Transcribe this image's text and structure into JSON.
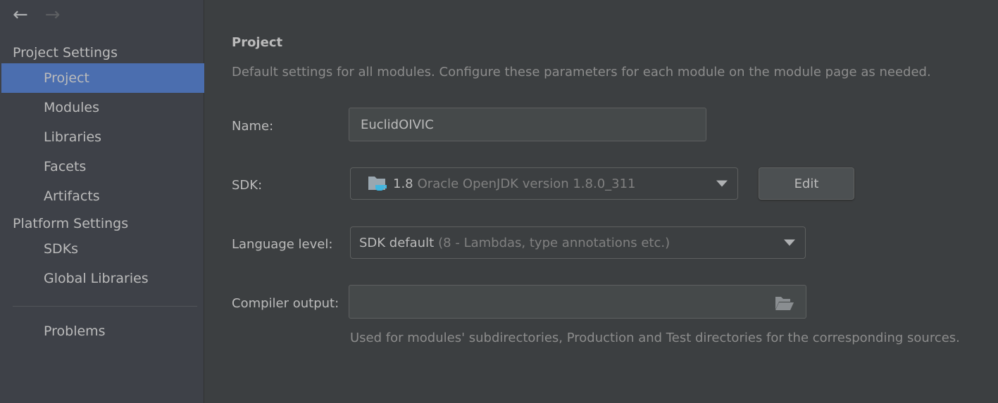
{
  "nav": {
    "back_icon": "arrow-left",
    "forward_icon": "arrow-right"
  },
  "sidebar": {
    "project_settings": "Project Settings",
    "project_items": [
      {
        "label": "Project",
        "selected": true
      },
      {
        "label": "Modules"
      },
      {
        "label": "Libraries"
      },
      {
        "label": "Facets"
      },
      {
        "label": "Artifacts"
      }
    ],
    "platform_settings": "Platform Settings",
    "platform_items": [
      {
        "label": "SDKs"
      },
      {
        "label": "Global Libraries"
      }
    ],
    "problems": "Problems",
    "selection_color": "#4b6eaf"
  },
  "main": {
    "title": "Project",
    "description": "Default settings for all modules. Configure these parameters for each module on the module page as needed.",
    "name_label": "Name:",
    "name_value": "EuclidOIVIC",
    "sdk_label": "SDK:",
    "sdk_version": "1.8",
    "sdk_detail": "Oracle OpenJDK version 1.8.0_311",
    "edit_label": "Edit",
    "language_label": "Language level:",
    "language_value": "SDK default",
    "language_detail": "(8 - Lambdas, type annotations etc.)",
    "compiler_label": "Compiler output:",
    "compiler_value": "",
    "compiler_hint": "Used for modules' subdirectories, Production and Test directories for the corresponding sources."
  }
}
